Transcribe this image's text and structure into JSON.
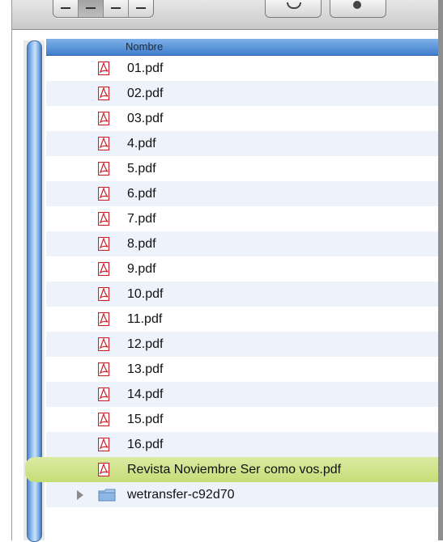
{
  "column_header": "Nombre",
  "files": [
    {
      "name": "01.pdf",
      "icon": "pdf-icon"
    },
    {
      "name": "02.pdf",
      "icon": "pdf-icon"
    },
    {
      "name": "03.pdf",
      "icon": "pdf-icon"
    },
    {
      "name": "4.pdf",
      "icon": "pdf-icon"
    },
    {
      "name": "5.pdf",
      "icon": "pdf-icon"
    },
    {
      "name": "6.pdf",
      "icon": "pdf-icon"
    },
    {
      "name": "7.pdf",
      "icon": "pdf-icon"
    },
    {
      "name": "8.pdf",
      "icon": "pdf-icon"
    },
    {
      "name": "9.pdf",
      "icon": "pdf-icon"
    },
    {
      "name": "10.pdf",
      "icon": "pdf-icon"
    },
    {
      "name": "11.pdf",
      "icon": "pdf-icon"
    },
    {
      "name": "12.pdf",
      "icon": "pdf-icon"
    },
    {
      "name": "13.pdf",
      "icon": "pdf-icon"
    },
    {
      "name": "14.pdf",
      "icon": "pdf-icon"
    },
    {
      "name": "15.pdf",
      "icon": "pdf-icon"
    },
    {
      "name": "16.pdf",
      "icon": "pdf-icon"
    },
    {
      "name": "Revista Noviembre Ser como vos.pdf",
      "icon": "pdf-icon",
      "selected": true
    }
  ],
  "folder": {
    "name": "wetransfer-c92d70",
    "icon": "folder-icon",
    "collapsed": true
  },
  "colors": {
    "header": "#3f7fcd",
    "selection": "#c5dd78",
    "pdf_icon": "#c8232c",
    "folder": "#8fb7e6"
  }
}
